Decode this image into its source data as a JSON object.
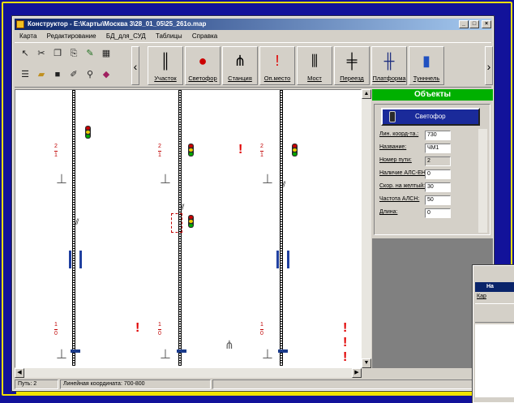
{
  "window": {
    "title": "Конструктор - E:\\Карты\\Москва 3\\28_01_05\\25_261o.map",
    "controls": [
      "_",
      "□",
      "×"
    ]
  },
  "menu": [
    "Карта",
    "Редактирование",
    "БД_для_СУД",
    "Таблицы",
    "Справка"
  ],
  "toolbar": {
    "small_tools_row1": [
      "pointer-icon",
      "cut-icon",
      "copy-icon",
      "paste-icon",
      "pen-icon",
      "grid-icon"
    ],
    "small_tools_row2": [
      "list-icon",
      "open-icon",
      "save-icon",
      "edit-icon",
      "binoculars-icon",
      "book-icon"
    ],
    "objects": [
      {
        "label": "Участок",
        "icon": "section-icon"
      },
      {
        "label": "Светофор",
        "icon": "signal-icon"
      },
      {
        "label": "Станция",
        "icon": "station-icon"
      },
      {
        "label": "Оп.место",
        "icon": "danger-spot-icon"
      },
      {
        "label": "Мост",
        "icon": "bridge-icon"
      },
      {
        "label": "Переезд",
        "icon": "crossing-icon"
      },
      {
        "label": "Платформа",
        "icon": "platform-icon"
      },
      {
        "label": "Тунннель",
        "icon": "tunnel-icon"
      }
    ]
  },
  "canvas": {
    "labels": [
      {
        "num": "2",
        "den": "1"
      },
      {
        "num": "2",
        "den": "1"
      },
      {
        "num": "2",
        "den": "1"
      },
      {
        "num": "1",
        "den": "0"
      },
      {
        "num": "1",
        "den": "0"
      },
      {
        "num": "1",
        "den": "0"
      }
    ]
  },
  "panel": {
    "title": "Объекты",
    "object_name": "Светофор",
    "properties": [
      {
        "label": "Лин. коорд-та.:",
        "value": "730"
      },
      {
        "label": "Название:",
        "value": "ЧМ1"
      },
      {
        "label": "Номер пути:",
        "value": "2"
      },
      {
        "label": "Наличие АЛС-ЕН:",
        "value": "0"
      },
      {
        "label": "Скор. на желтый:",
        "value": "30"
      },
      {
        "label": "Частота АЛСН:",
        "value": "50"
      },
      {
        "label": "Длина:",
        "value": "0"
      }
    ]
  },
  "status": {
    "path": "Путь: 2",
    "coord": "Линейная координата: 700-800"
  },
  "second_window": {
    "title": "На",
    "menu": "Кар"
  },
  "colors": {
    "background": "#12129a",
    "accent_yellow": "#f1e400",
    "panel_green": "#00b000",
    "signal_red": "#e00000"
  }
}
